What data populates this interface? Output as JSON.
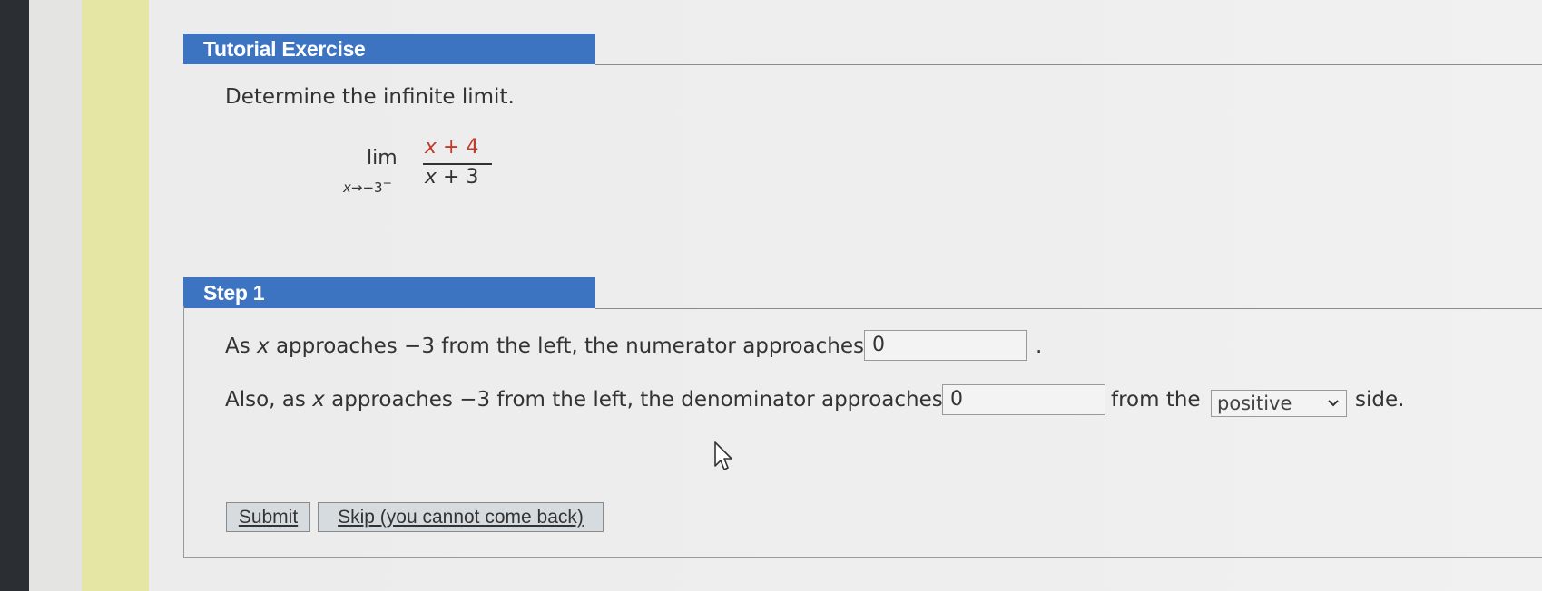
{
  "exercise": {
    "header": "Tutorial Exercise",
    "prompt": "Determine the infinite limit.",
    "limit": {
      "operator": "lim",
      "approach_var": "x",
      "approach_arrow": "→",
      "approach_value": "−3",
      "approach_side": "−",
      "numerator_var": "x",
      "numerator_rest": " + 4",
      "denominator_var": "x",
      "denominator_rest": " + 3"
    }
  },
  "step1": {
    "header": "Step 1",
    "line1": {
      "pre": "As ",
      "var": "x",
      "post": " approaches −3 from the left, the numerator approaches",
      "answer": "0",
      "end": "."
    },
    "line2": {
      "pre": "Also, as ",
      "var": "x",
      "post": " approaches −3 from the left, the denominator approaches",
      "answer": "0",
      "mid": "from the",
      "select_value": "positive",
      "end": "side."
    }
  },
  "buttons": {
    "submit": "Submit",
    "skip": "Skip (you cannot come back)"
  },
  "colors": {
    "header_bar": "#3d74c2",
    "numerator_text": "#c0392b",
    "sidebar_yellow": "#e6e6a4"
  }
}
